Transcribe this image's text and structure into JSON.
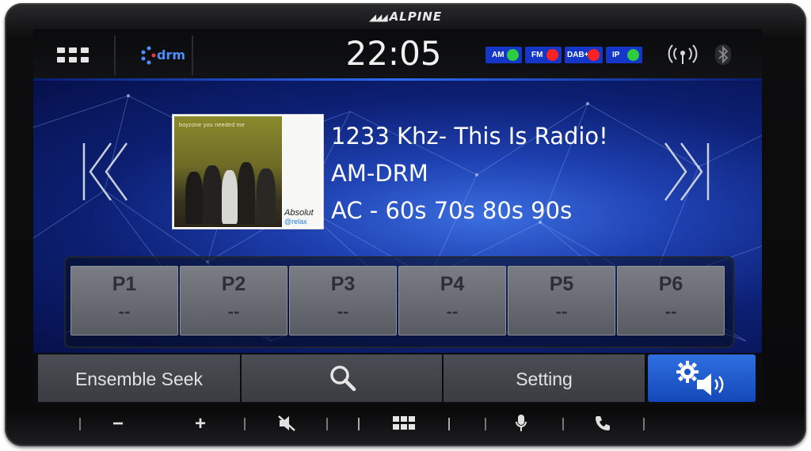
{
  "device": {
    "brand": "ALPINE"
  },
  "status_bar": {
    "time": "22:05",
    "logo_text": "drm",
    "sources": [
      {
        "label": "AM",
        "color": "#2ecc40"
      },
      {
        "label": "FM",
        "color": "#ff2222"
      },
      {
        "label": "DAB+",
        "color": "#ff2222"
      },
      {
        "label": "IP",
        "color": "#2ecc40"
      }
    ]
  },
  "now_playing": {
    "line1": "1233 Khz- This Is Radio!",
    "line2": "AM-DRM",
    "line3": "AC - 60s 70s 80s 90s",
    "album_caption": "boyzone you needed me",
    "album_label_1": "Absolut",
    "album_label_2": "@relax"
  },
  "presets": [
    {
      "label": "P1",
      "value": "--"
    },
    {
      "label": "P2",
      "value": "--"
    },
    {
      "label": "P3",
      "value": "--"
    },
    {
      "label": "P4",
      "value": "--"
    },
    {
      "label": "P5",
      "value": "--"
    },
    {
      "label": "P6",
      "value": "--"
    }
  ],
  "bottom_bar": {
    "ensemble_seek": "Ensemble Seek",
    "setting": "Setting"
  },
  "hardware_keys": {
    "minus": "−",
    "plus": "+"
  }
}
